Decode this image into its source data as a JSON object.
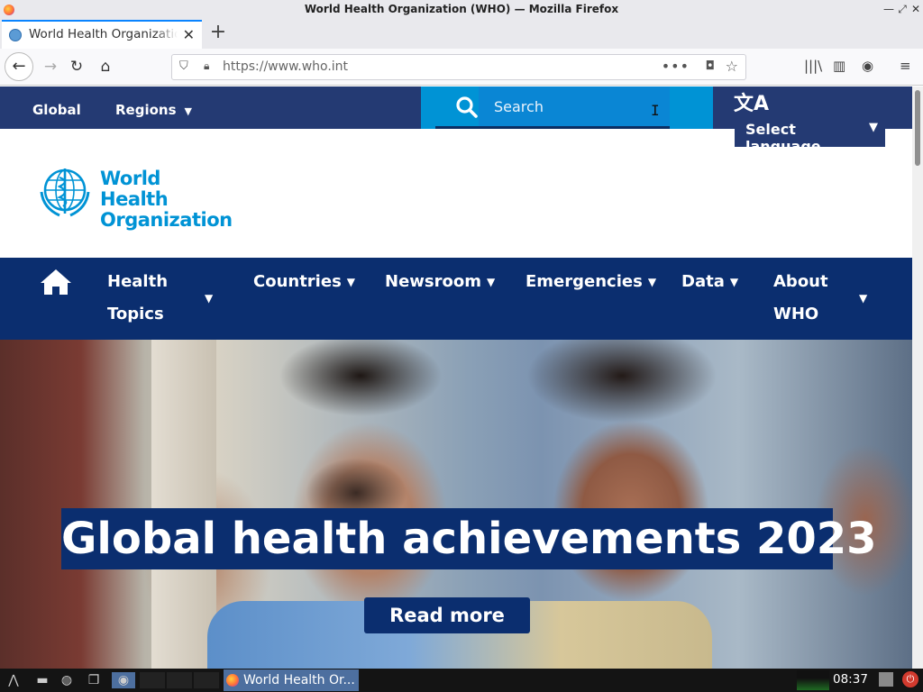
{
  "window": {
    "title": "World Health Organization (WHO) — Mozilla Firefox"
  },
  "tabs": [
    {
      "label": "World Health Organizatio",
      "active": true
    }
  ],
  "navbar": {
    "url": "https://www.who.int"
  },
  "who_top": {
    "global_label": "Global",
    "regions_label": "Regions",
    "search_placeholder": "Search",
    "language_label": "Select language"
  },
  "logo": {
    "line1": "World Health",
    "line2": "Organization"
  },
  "main_nav": {
    "items": [
      {
        "label_1": "Health",
        "label_2": "Topics"
      },
      {
        "label": "Countries"
      },
      {
        "label": "Newsroom"
      },
      {
        "label": "Emergencies"
      },
      {
        "label": "Data"
      },
      {
        "label_1": "About",
        "label_2": "WHO"
      }
    ]
  },
  "hero": {
    "title": "Global health achievements 2023",
    "cta_label": "Read more"
  },
  "taskbar": {
    "task_label": "World Health Or...",
    "clock": "08:37"
  },
  "colors": {
    "who_blue": "#0093d5",
    "who_navy": "#0b2e6f",
    "top_strip": "#243a73"
  }
}
